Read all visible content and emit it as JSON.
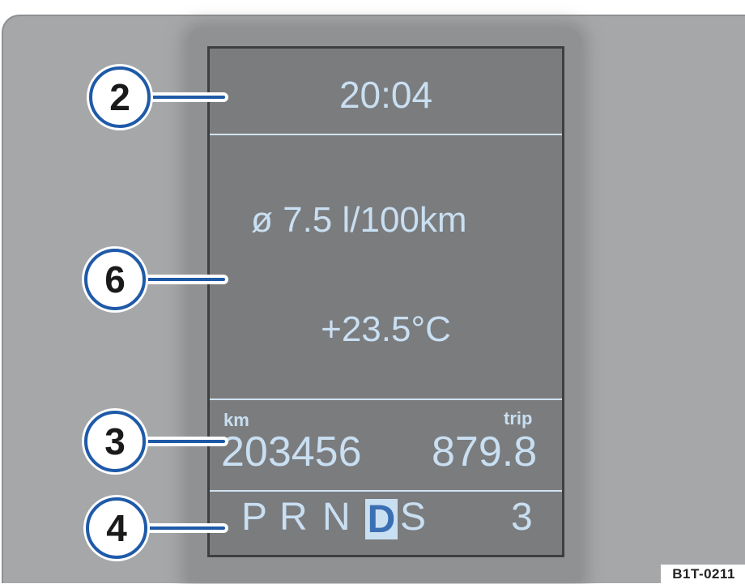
{
  "display": {
    "time": "20:04",
    "consumption": "ø 7.5 l/100km",
    "temperature": "+23.5°C",
    "odometer_label": "km",
    "odometer_value": "203456",
    "trip_label": "trip",
    "trip_value": "879.8",
    "gears": [
      "P",
      "R",
      "N",
      "D",
      "S"
    ],
    "selected_gear": "D",
    "gear_number": "3"
  },
  "callouts": [
    "2",
    "6",
    "3",
    "4"
  ],
  "figure_code": "B1T-0211",
  "colors": {
    "display_text": "#c9dff2",
    "callout_border": "#1f5aa8",
    "screen_bg": "#7b7c7e",
    "panel_bg": "#a6a7a8"
  }
}
